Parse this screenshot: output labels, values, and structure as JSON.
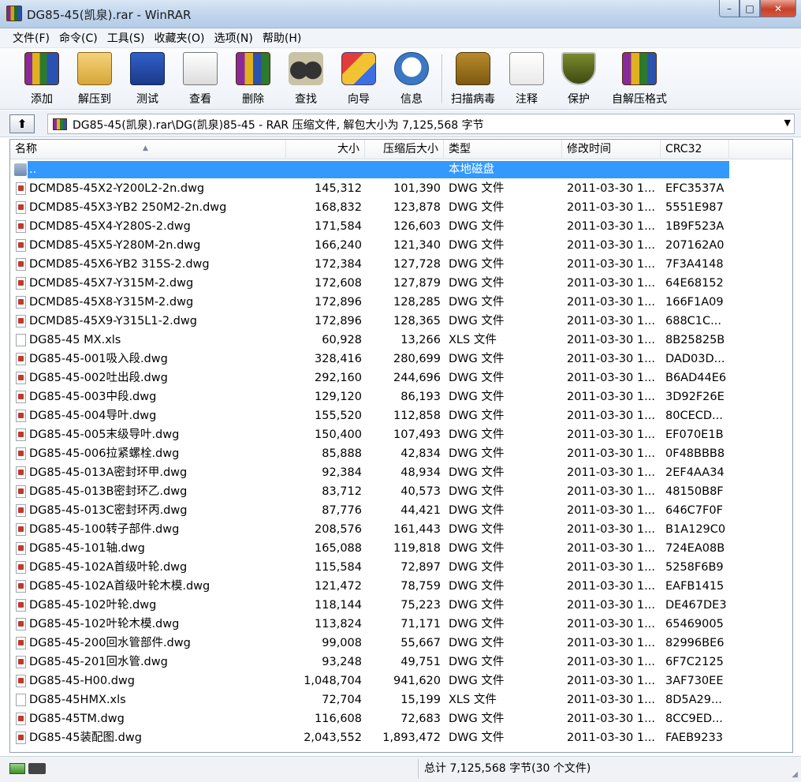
{
  "window": {
    "title": "DG85-45(凯泉).rar - WinRAR",
    "minimize_glyph": "–",
    "maximize_glyph": "□",
    "close_glyph": "✕"
  },
  "menu": [
    "文件(F)",
    "命令(C)",
    "工具(S)",
    "收藏夹(O)",
    "选项(N)",
    "帮助(H)"
  ],
  "toolbar": [
    {
      "label": "添加",
      "icon": "add-archive-icon"
    },
    {
      "label": "解压到",
      "icon": "extract-to-icon"
    },
    {
      "label": "测试",
      "icon": "test-icon"
    },
    {
      "label": "查看",
      "icon": "view-icon"
    },
    {
      "label": "删除",
      "icon": "delete-icon"
    },
    {
      "label": "查找",
      "icon": "find-binoculars-icon"
    },
    {
      "label": "向导",
      "icon": "wizard-icon"
    },
    {
      "label": "信息",
      "icon": "info-icon"
    },
    {
      "label": "扫描病毒",
      "icon": "virus-scan-icon"
    },
    {
      "label": "注释",
      "icon": "comment-icon"
    },
    {
      "label": "保护",
      "icon": "protect-shield-icon"
    },
    {
      "label": "自解压格式",
      "icon": "sfx-icon"
    }
  ],
  "address": {
    "path": "DG85-45(凯泉).rar\\DG(凯泉)85-45 - RAR 压缩文件, 解包大小为 7,125,568 字节"
  },
  "columns": {
    "name": "名称",
    "size": "大小",
    "packed": "压缩后大小",
    "type": "类型",
    "modified": "修改时间",
    "crc": "CRC32"
  },
  "parent_row": {
    "name": "..",
    "type": "本地磁盘"
  },
  "files": [
    {
      "name": "DCMD85-45X2-Y200L2-2n.dwg",
      "size": "145,312",
      "packed": "101,390",
      "type": "DWG 文件",
      "modified": "2011-03-30 1...",
      "crc": "EFC3537A",
      "kind": "dwg"
    },
    {
      "name": "DCMD85-45X3-YB2 250M2-2n.dwg",
      "size": "168,832",
      "packed": "123,878",
      "type": "DWG 文件",
      "modified": "2011-03-30 1...",
      "crc": "5551E987",
      "kind": "dwg"
    },
    {
      "name": "DCMD85-45X4-Y280S-2.dwg",
      "size": "171,584",
      "packed": "126,603",
      "type": "DWG 文件",
      "modified": "2011-03-30 1...",
      "crc": "1B9F523A",
      "kind": "dwg"
    },
    {
      "name": "DCMD85-45X5-Y280M-2n.dwg",
      "size": "166,240",
      "packed": "121,340",
      "type": "DWG 文件",
      "modified": "2011-03-30 1...",
      "crc": "207162A0",
      "kind": "dwg"
    },
    {
      "name": "DCMD85-45X6-YB2 315S-2.dwg",
      "size": "172,384",
      "packed": "127,728",
      "type": "DWG 文件",
      "modified": "2011-03-30 1...",
      "crc": "7F3A4148",
      "kind": "dwg"
    },
    {
      "name": "DCMD85-45X7-Y315M-2.dwg",
      "size": "172,608",
      "packed": "127,879",
      "type": "DWG 文件",
      "modified": "2011-03-30 1...",
      "crc": "64E68152",
      "kind": "dwg"
    },
    {
      "name": "DCMD85-45X8-Y315M-2.dwg",
      "size": "172,896",
      "packed": "128,285",
      "type": "DWG 文件",
      "modified": "2011-03-30 1...",
      "crc": "166F1A09",
      "kind": "dwg"
    },
    {
      "name": "DCMD85-45X9-Y315L1-2.dwg",
      "size": "172,896",
      "packed": "128,365",
      "type": "DWG 文件",
      "modified": "2011-03-30 1...",
      "crc": "688C1C...",
      "kind": "dwg"
    },
    {
      "name": "DG85-45 MX.xls",
      "size": "60,928",
      "packed": "13,266",
      "type": "XLS 文件",
      "modified": "2011-03-30 1...",
      "crc": "8B25825B",
      "kind": "xls"
    },
    {
      "name": "DG85-45-001吸入段.dwg",
      "size": "328,416",
      "packed": "280,699",
      "type": "DWG 文件",
      "modified": "2011-03-30 1...",
      "crc": "DAD03D...",
      "kind": "dwg"
    },
    {
      "name": "DG85-45-002吐出段.dwg",
      "size": "292,160",
      "packed": "244,696",
      "type": "DWG 文件",
      "modified": "2011-03-30 1...",
      "crc": "B6AD44E6",
      "kind": "dwg"
    },
    {
      "name": "DG85-45-003中段.dwg",
      "size": "129,120",
      "packed": "86,193",
      "type": "DWG 文件",
      "modified": "2011-03-30 1...",
      "crc": "3D92F26E",
      "kind": "dwg"
    },
    {
      "name": "DG85-45-004导叶.dwg",
      "size": "155,520",
      "packed": "112,858",
      "type": "DWG 文件",
      "modified": "2011-03-30 1...",
      "crc": "80CECD...",
      "kind": "dwg"
    },
    {
      "name": "DG85-45-005末级导叶.dwg",
      "size": "150,400",
      "packed": "107,493",
      "type": "DWG 文件",
      "modified": "2011-03-30 1...",
      "crc": "EF070E1B",
      "kind": "dwg"
    },
    {
      "name": "DG85-45-006拉紧螺栓.dwg",
      "size": "85,888",
      "packed": "42,834",
      "type": "DWG 文件",
      "modified": "2011-03-30 1...",
      "crc": "0F48BBB8",
      "kind": "dwg"
    },
    {
      "name": "DG85-45-013A密封环甲.dwg",
      "size": "92,384",
      "packed": "48,934",
      "type": "DWG 文件",
      "modified": "2011-03-30 1...",
      "crc": "2EF4AA34",
      "kind": "dwg"
    },
    {
      "name": "DG85-45-013B密封环乙.dwg",
      "size": "83,712",
      "packed": "40,573",
      "type": "DWG 文件",
      "modified": "2011-03-30 1...",
      "crc": "48150B8F",
      "kind": "dwg"
    },
    {
      "name": "DG85-45-013C密封环丙.dwg",
      "size": "87,776",
      "packed": "44,421",
      "type": "DWG 文件",
      "modified": "2011-03-30 1...",
      "crc": "646C7F0F",
      "kind": "dwg"
    },
    {
      "name": "DG85-45-100转子部件.dwg",
      "size": "208,576",
      "packed": "161,443",
      "type": "DWG 文件",
      "modified": "2011-03-30 1...",
      "crc": "B1A129C0",
      "kind": "dwg"
    },
    {
      "name": "DG85-45-101轴.dwg",
      "size": "165,088",
      "packed": "119,818",
      "type": "DWG 文件",
      "modified": "2011-03-30 1...",
      "crc": "724EA08B",
      "kind": "dwg"
    },
    {
      "name": "DG85-45-102A首级叶轮.dwg",
      "size": "115,584",
      "packed": "72,897",
      "type": "DWG 文件",
      "modified": "2011-03-30 1...",
      "crc": "5258F6B9",
      "kind": "dwg"
    },
    {
      "name": "DG85-45-102A首级叶轮木模.dwg",
      "size": "121,472",
      "packed": "78,759",
      "type": "DWG 文件",
      "modified": "2011-03-30 1...",
      "crc": "EAFB1415",
      "kind": "dwg"
    },
    {
      "name": "DG85-45-102叶轮.dwg",
      "size": "118,144",
      "packed": "75,223",
      "type": "DWG 文件",
      "modified": "2011-03-30 1...",
      "crc": "DE467DE3",
      "kind": "dwg"
    },
    {
      "name": "DG85-45-102叶轮木模.dwg",
      "size": "113,824",
      "packed": "71,171",
      "type": "DWG 文件",
      "modified": "2011-03-30 1...",
      "crc": "65469005",
      "kind": "dwg"
    },
    {
      "name": "DG85-45-200回水管部件.dwg",
      "size": "99,008",
      "packed": "55,667",
      "type": "DWG 文件",
      "modified": "2011-03-30 1...",
      "crc": "82996BE6",
      "kind": "dwg"
    },
    {
      "name": "DG85-45-201回水管.dwg",
      "size": "93,248",
      "packed": "49,751",
      "type": "DWG 文件",
      "modified": "2011-03-30 1...",
      "crc": "6F7C2125",
      "kind": "dwg"
    },
    {
      "name": "DG85-45-H00.dwg",
      "size": "1,048,704",
      "packed": "941,620",
      "type": "DWG 文件",
      "modified": "2011-03-30 1...",
      "crc": "3AF730EE",
      "kind": "dwg"
    },
    {
      "name": "DG85-45HMX.xls",
      "size": "72,704",
      "packed": "15,199",
      "type": "XLS 文件",
      "modified": "2011-03-30 1...",
      "crc": "8D5A29...",
      "kind": "xls"
    },
    {
      "name": "DG85-45TM.dwg",
      "size": "116,608",
      "packed": "72,683",
      "type": "DWG 文件",
      "modified": "2011-03-30 1...",
      "crc": "8CC9ED...",
      "kind": "dwg"
    },
    {
      "name": "DG85-45装配图.dwg",
      "size": "2,043,552",
      "packed": "1,893,472",
      "type": "DWG 文件",
      "modified": "2011-03-30 1...",
      "crc": "FAEB9233",
      "kind": "dwg"
    }
  ],
  "status": {
    "total": "总计 7,125,568 字节(30 个文件)"
  },
  "colors": {
    "selection": "#3399ff",
    "titlebar": "#c3d7ee"
  }
}
